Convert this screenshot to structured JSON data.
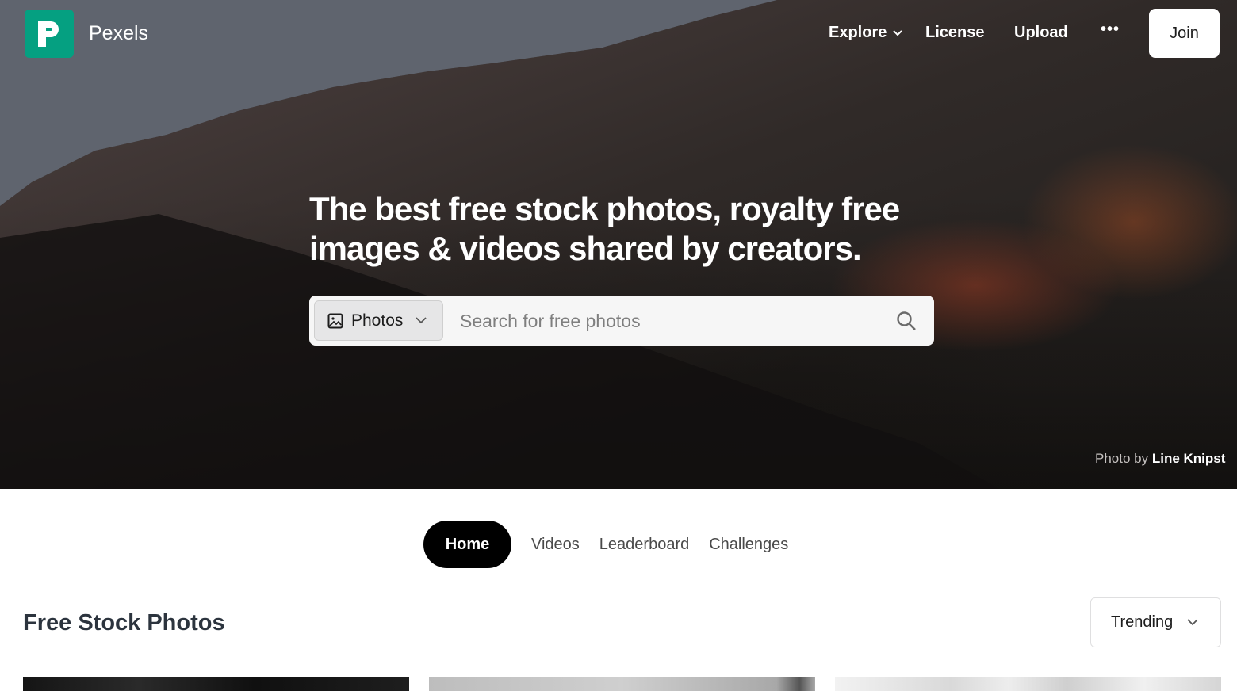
{
  "brand": {
    "name": "Pexels",
    "accent": "#05a081"
  },
  "nav": {
    "explore": "Explore",
    "license": "License",
    "upload": "Upload",
    "more": "•••",
    "join": "Join"
  },
  "hero": {
    "headline_line1": "The best free stock photos, royalty free",
    "headline_line2": "images & videos shared by creators.",
    "credit_prefix": "Photo by",
    "credit_name": "Line Knipst"
  },
  "search": {
    "type_selected": "Photos",
    "placeholder": "Search for free photos",
    "value": ""
  },
  "tabs": [
    {
      "label": "Home",
      "active": true
    },
    {
      "label": "Videos",
      "active": false
    },
    {
      "label": "Leaderboard",
      "active": false
    },
    {
      "label": "Challenges",
      "active": false
    }
  ],
  "main": {
    "section_title": "Free Stock Photos",
    "sort_selected": "Trending"
  }
}
